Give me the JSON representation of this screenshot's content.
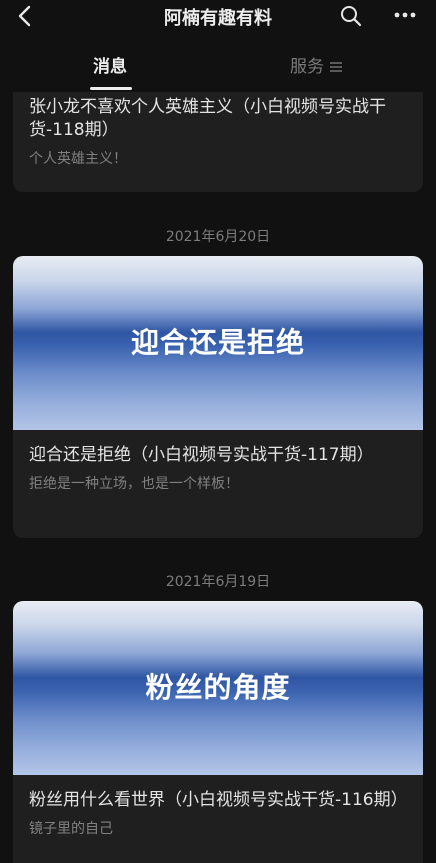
{
  "header": {
    "title": "阿楠有趣有料",
    "back_icon": "back-chevron-icon",
    "search_icon": "search-icon",
    "more_icon": "more-dots-icon"
  },
  "tabs": [
    {
      "label": "消息",
      "active": true
    },
    {
      "label": "服务",
      "active": false,
      "icon": "menu-lines-icon"
    }
  ],
  "feed": {
    "partial_card": {
      "title": "张小龙不喜欢个人英雄主义（小白视频号实战干货-118期）",
      "description": "个人英雄主义！"
    },
    "groups": [
      {
        "date": "2021年6月20日",
        "cover_text": "迎合还是拒绝",
        "title": "迎合还是拒绝（小白视频号实战干货-117期）",
        "description": "拒绝是一种立场，也是一个样板！"
      },
      {
        "date": "2021年6月19日",
        "cover_text": "粉丝的角度",
        "title": "粉丝用什么看世界（小白视频号实战干货-116期）",
        "description": "镜子里的自己"
      }
    ]
  },
  "colors": {
    "background": "#111111",
    "card": "#1f1f1f",
    "cover_blue": "#2f56a4"
  }
}
